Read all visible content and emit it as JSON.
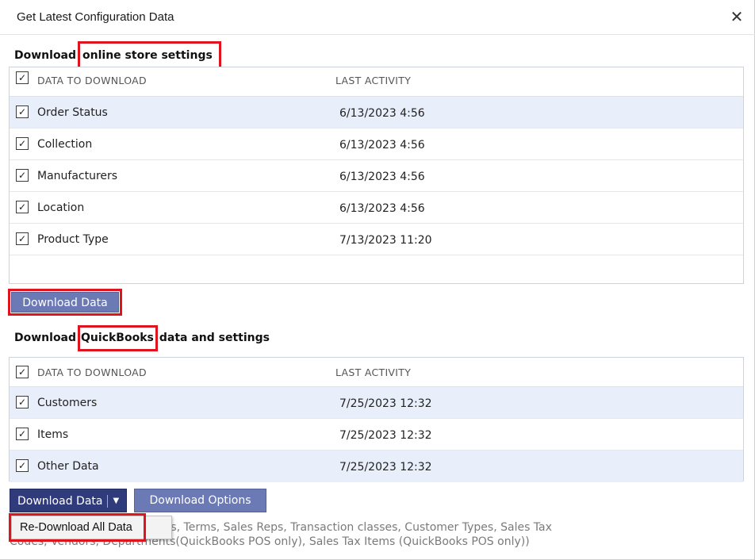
{
  "window": {
    "title": "Get Latest Configuration Data",
    "close_label": "✕"
  },
  "store_section": {
    "title_prefix": "Download",
    "title_highlight": "online store settings",
    "headers": {
      "data": "DATA TO DOWNLOAD",
      "activity": "LAST ACTIVITY"
    },
    "rows": [
      {
        "name": "Order Status",
        "date": "6/13/2023 4:56",
        "checked": true
      },
      {
        "name": "Collection",
        "date": "6/13/2023 4:56",
        "checked": true
      },
      {
        "name": "Manufacturers",
        "date": "6/13/2023 4:56",
        "checked": true
      },
      {
        "name": "Location",
        "date": "6/13/2023 4:56",
        "checked": true
      },
      {
        "name": "Product Type",
        "date": "7/13/2023 11:20",
        "checked": true
      }
    ],
    "button_label": "Download Data"
  },
  "qb_section": {
    "title_prefix": "Download",
    "title_highlight": "QuickBooks",
    "title_suffix": "data and settings",
    "headers": {
      "data": "DATA TO DOWNLOAD",
      "activity": "LAST ACTIVITY"
    },
    "rows": [
      {
        "name": "Customers",
        "date": "7/25/2023 12:32",
        "checked": true
      },
      {
        "name": "Items",
        "date": "7/25/2023 12:32",
        "checked": true
      },
      {
        "name": "Other Data",
        "date": "7/25/2023 12:32",
        "checked": true
      }
    ],
    "split_button_label": "Download Data",
    "options_button_label": "Download Options",
    "description_line1": "nts, Terms, Sales Reps, Transaction classes, Customer Types, Sales Tax",
    "description_line2": "Codes, Vendors, Departments(QuickBooks POS only), Sales Tax Items (QuickBooks POS only))",
    "dropdown_item": "Re-Download All Data"
  },
  "check_glyph": "✓",
  "colors": {
    "highlight_border": "#e0141e",
    "button": "#6b7ab5",
    "button_dark": "#2f3b7a",
    "row_alt": "#e9eefb"
  }
}
